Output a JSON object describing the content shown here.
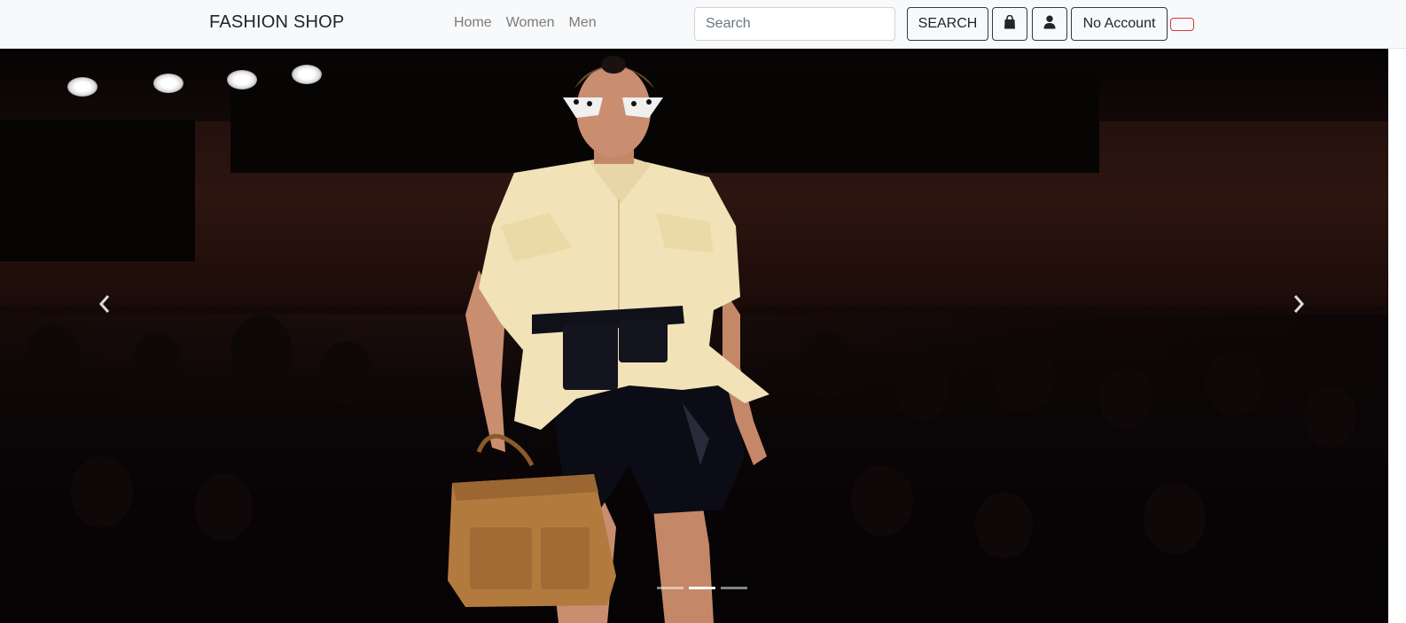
{
  "navbar": {
    "brand": "FASHION SHOP",
    "links": [
      "Home",
      "Women",
      "Men"
    ],
    "search": {
      "placeholder": "Search",
      "value": ""
    },
    "search_button": "SEARCH",
    "bag_icon": "shopping-bag-icon",
    "user_icon": "user-icon",
    "account_button": "No Account",
    "colors": {
      "background": "#f8f9fa",
      "link": "#7a7a7a",
      "danger": "#dc3545"
    }
  },
  "carousel": {
    "slide_image": "runway-model-photo",
    "prev_icon": "chevron-left-icon",
    "next_icon": "chevron-right-icon",
    "slides_total": 3,
    "active_slide": 2
  }
}
